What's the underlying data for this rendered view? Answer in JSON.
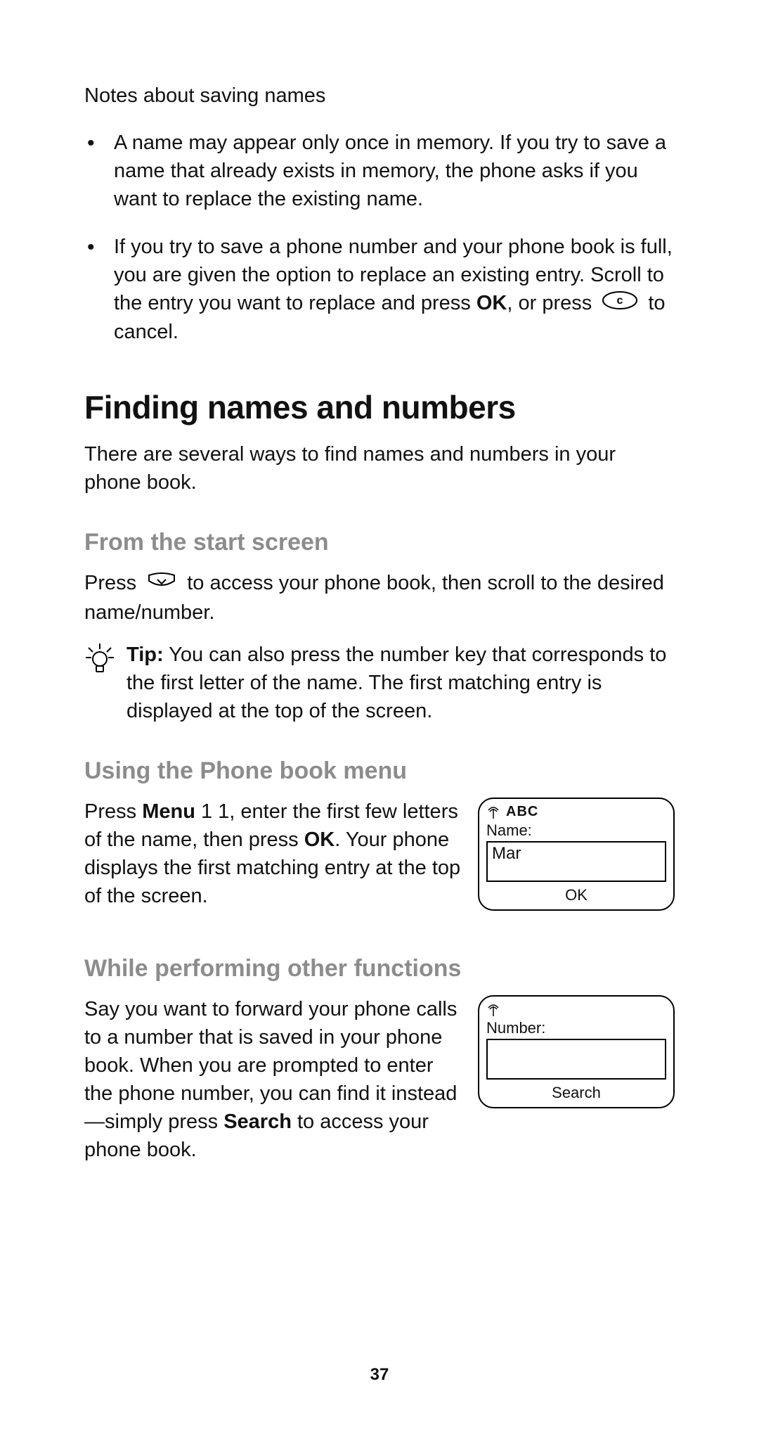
{
  "top": {
    "notes_heading": "Notes about saving names",
    "bullet1": "A name may appear only once in memory. If you try to save a name that already exists in memory, the phone asks if you want to replace the existing name.",
    "bullet2_a": "If you try to save a phone number and your phone book is full, you are given the option to replace an existing entry. Scroll to the entry you want to replace and press ",
    "bullet2_ok": "OK",
    "bullet2_b": ", or press ",
    "bullet2_c": " to cancel.",
    "c_key_icon": "c-key"
  },
  "section": {
    "heading": "Finding names and numbers",
    "intro": "There are several ways to find names and numbers in your phone book."
  },
  "start_screen": {
    "heading": "From the start screen",
    "para_a": "Press ",
    "nav_icon": "nav-down-key",
    "para_b": " to access your phone book, then scroll to the desired name/number.",
    "tip_label": "Tip:",
    "tip_text": "  You can also press the number key that corresponds to the first letter of the name. The first matching entry is displayed at the top of the screen."
  },
  "menu": {
    "heading": "Using the Phone book menu",
    "para_a": "Press ",
    "para_menu": "Menu",
    "para_b": " 1 1, enter the first few letters of the name, then press ",
    "para_ok": "OK",
    "para_c": ". Your phone displays the first matching entry at the top of the screen.",
    "screen": {
      "mode": "ABC",
      "label": "Name:",
      "value": "Mar",
      "softkey": "OK"
    }
  },
  "other": {
    "heading": "While performing other functions",
    "para_a": "Say you want to forward your phone calls to a number that is saved in your phone book. When you are prompted to enter the phone number, you can find it instead—simply press ",
    "para_search": "Search",
    "para_b": " to access your phone book.",
    "screen": {
      "label": "Number:",
      "value": "",
      "softkey": "Search"
    }
  },
  "page_number": "37"
}
